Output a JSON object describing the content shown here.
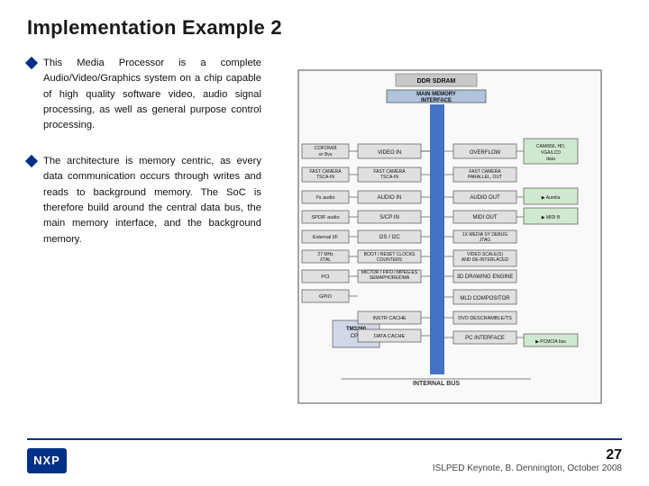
{
  "title": "Implementation Example 2",
  "bullets": [
    {
      "id": "bullet1",
      "text": "This Media Processor is a complete Audio/Video/Graphics system on a chip capable of high quality software video, audio signal processing, as well as general purpose control processing."
    },
    {
      "id": "bullet2",
      "text": "The architecture is memory centric, as every data communication occurs through writes and reads to background memory. The SoC is therefore build around the central data bus, the main memory interface, and the background memory."
    }
  ],
  "footer": {
    "slide_number": "27",
    "citation": "ISLPED Keynote, B. Dennington, October 2008"
  },
  "logo": {
    "text": "NXP"
  }
}
